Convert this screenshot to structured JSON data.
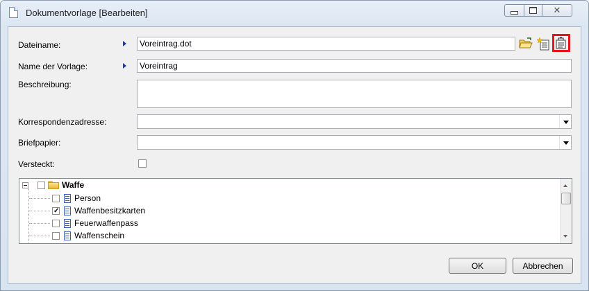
{
  "window": {
    "title": "Dokumentvorlage [Bearbeiten]",
    "close_glyph": "✕"
  },
  "form": {
    "dateiname": {
      "label": "Dateiname:",
      "value": "Voreintrag.dot"
    },
    "name": {
      "label": "Name der Vorlage:",
      "value": "Voreintrag"
    },
    "beschreibung": {
      "label": "Beschreibung:",
      "value": ""
    },
    "korrespondenz": {
      "label": "Korrespondenzadresse:",
      "value": ""
    },
    "briefpapier": {
      "label": "Briefpapier:",
      "value": ""
    },
    "versteckt": {
      "label": "Versteckt:",
      "checked": false
    }
  },
  "toolbar_icons": [
    "open-folder-icon",
    "new-document-icon",
    "edit-properties-icon"
  ],
  "tree": {
    "root": {
      "label": "Waffe",
      "checked": false,
      "expanded": true
    },
    "children": [
      {
        "label": "Person",
        "checked": false
      },
      {
        "label": "Waffenbesitzkarten",
        "checked": true
      },
      {
        "label": "Feuerwaffenpass",
        "checked": false
      },
      {
        "label": "Waffenschein",
        "checked": false
      }
    ]
  },
  "buttons": {
    "ok": "OK",
    "cancel": "Abbrechen"
  },
  "colors": {
    "highlight": "#e8141b",
    "arrow": "#1f3e9e"
  }
}
